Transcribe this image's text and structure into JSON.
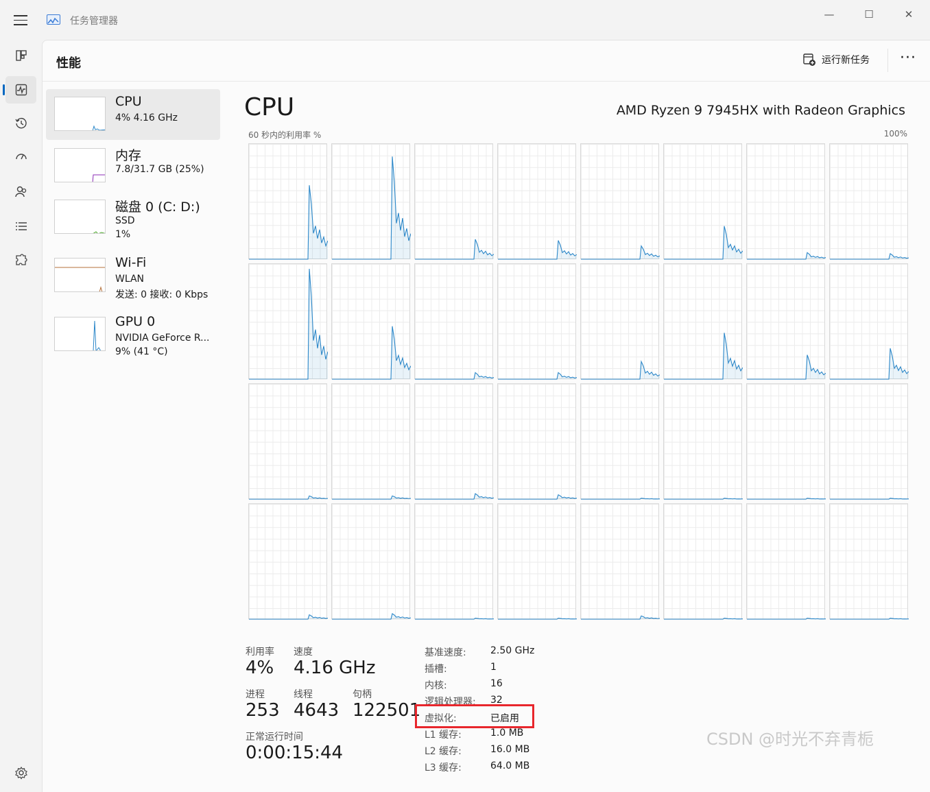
{
  "window": {
    "title": "任务管理器",
    "controls": [
      "—",
      "☐",
      "✕"
    ]
  },
  "header": {
    "page_title": "性能",
    "run_task_label": "运行新任务",
    "more_label": "···"
  },
  "resources": [
    {
      "name": "CPU",
      "line1": "4% 4.16 GHz"
    },
    {
      "name": "内存",
      "line1": "7.8/31.7 GB (25%)"
    },
    {
      "name": "磁盘 0 (C: D:)",
      "line1": "SSD",
      "line2": "1%"
    },
    {
      "name": "Wi-Fi",
      "line1": "WLAN",
      "line2": "发送: 0 接收: 0 Kbps"
    },
    {
      "name": "GPU 0",
      "line1": "NVIDIA GeForce R...",
      "line2": "9% (41 °C)"
    }
  ],
  "cpu": {
    "title": "CPU",
    "model": "AMD Ryzen 9 7945HX with Radeon Graphics",
    "axis_label": "60 秒内的利用率 %",
    "axis_max": "100%"
  },
  "stats": {
    "utilization_label": "利用率",
    "utilization": "4%",
    "speed_label": "速度",
    "speed": "4.16 GHz",
    "processes_label": "进程",
    "processes": "253",
    "threads_label": "线程",
    "threads": "4643",
    "handles_label": "句柄",
    "handles": "122501",
    "uptime_label": "正常运行时间",
    "uptime": "0:00:15:44"
  },
  "details": [
    {
      "label": "基准速度:",
      "value": "2.50 GHz"
    },
    {
      "label": "插槽:",
      "value": "1"
    },
    {
      "label": "内核:",
      "value": "16"
    },
    {
      "label": "逻辑处理器:",
      "value": "32"
    },
    {
      "label": "虚拟化:",
      "value": "已启用"
    },
    {
      "label": "L1 缓存:",
      "value": "1.0 MB"
    },
    {
      "label": "L2 缓存:",
      "value": "16.0 MB"
    },
    {
      "label": "L3 缓存:",
      "value": "64.0 MB"
    }
  ],
  "core_spikes": [
    0.67,
    0.93,
    0.18,
    0.17,
    0.12,
    0.3,
    0.06,
    0.05,
    1.0,
    0.48,
    0.06,
    0.06,
    0.16,
    0.42,
    0.22,
    0.28,
    0.03,
    0.03,
    0.05,
    0.04,
    0.01,
    0.01,
    0.01,
    0.01,
    0.04,
    0.05,
    0.01,
    0.01,
    0.03,
    0.01,
    0.01,
    0.01
  ],
  "colors": {
    "accent": "#0067c0",
    "line": "#2a86c8",
    "highlight": "#e8262c"
  },
  "watermark": "CSDN @时光不弃青栀"
}
